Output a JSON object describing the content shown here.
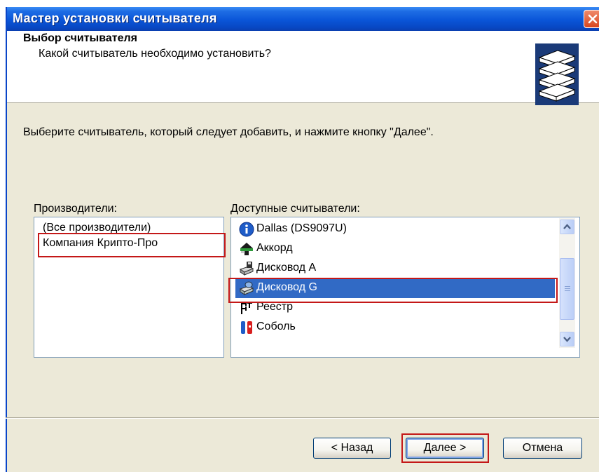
{
  "window": {
    "title": "Мастер установки считывателя"
  },
  "header": {
    "title": "Выбор считывателя",
    "subtitle": "Какой считыватель необходимо установить?"
  },
  "instruction": "Выберите считыватель, который следует добавить, и нажмите кнопку \"Далее\".",
  "manufacturers": {
    "label": "Производители:",
    "items": [
      {
        "label": "(Все производители)"
      },
      {
        "label": "Компания Крипто-Про",
        "highlighted": true
      }
    ]
  },
  "readers": {
    "label": "Доступные считыватели:",
    "items": [
      {
        "label": "Dallas (DS9097U)",
        "icon": "info-icon"
      },
      {
        "label": "Аккорд",
        "icon": "accord-icon"
      },
      {
        "label": "Дисковод A",
        "icon": "floppy-drive-icon"
      },
      {
        "label": "Дисковод G",
        "icon": "disk-drive-icon",
        "selected": true
      },
      {
        "label": "Реестр",
        "icon": "registry-icon"
      },
      {
        "label": "Соболь",
        "icon": "sobol-icon"
      }
    ]
  },
  "buttons": {
    "back": "< Назад",
    "next": "Далее >",
    "cancel": "Отмена"
  },
  "colors": {
    "titlebar": "#0a55d8",
    "selection": "#316ac5",
    "highlight_box": "#c41818",
    "dialog_bg": "#ece9d8"
  }
}
